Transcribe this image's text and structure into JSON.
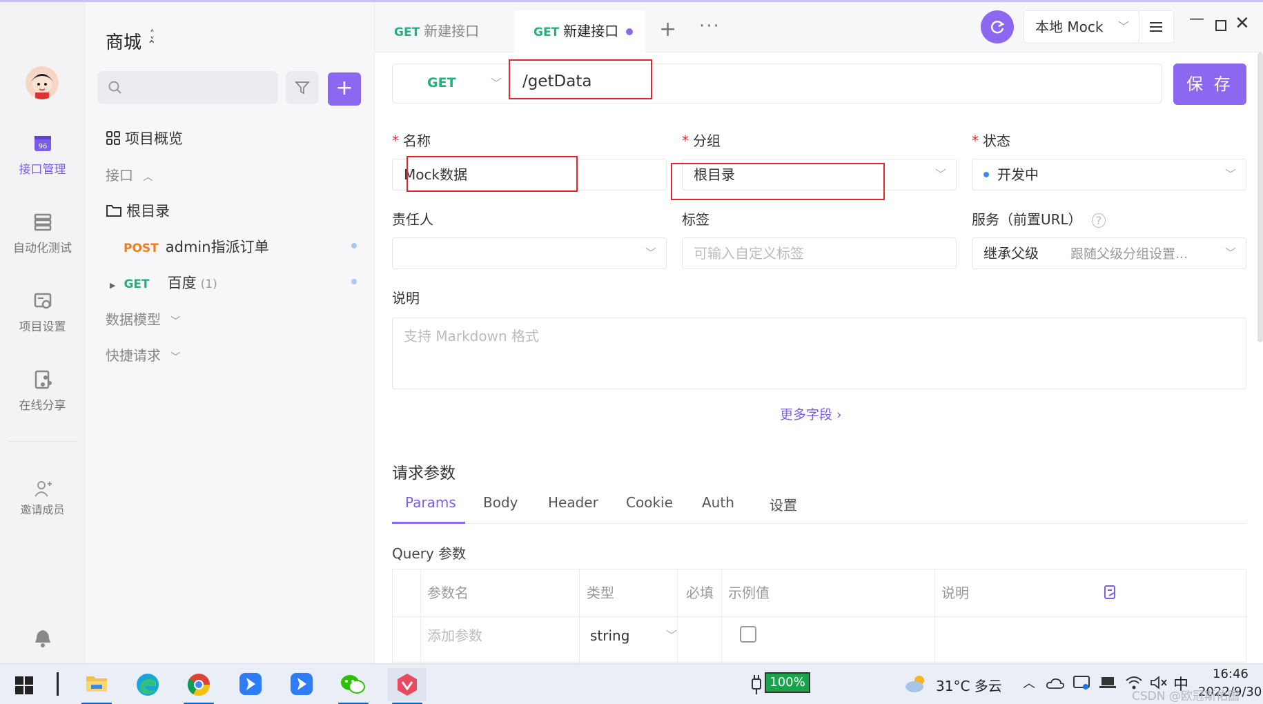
{
  "project": {
    "title": "商城",
    "switch_icon": "updown-icon"
  },
  "rail": {
    "items": [
      {
        "label": "接口管理",
        "icon": "api-icon"
      },
      {
        "label": "自动化测试",
        "icon": "layers-icon"
      },
      {
        "label": "项目设置",
        "icon": "settings-icon"
      },
      {
        "label": "在线分享",
        "icon": "share-icon"
      },
      {
        "label": "邀请成员",
        "icon": "invite-icon"
      }
    ]
  },
  "panel": {
    "overview": "项目概览",
    "api_section": "接口",
    "root_folder": "根目录",
    "items": [
      {
        "method": "POST",
        "name": "admin指派订单"
      },
      {
        "method": "GET",
        "name": "百度",
        "count": "(1)"
      }
    ],
    "data_model": "数据模型",
    "quick_request": "快捷请求"
  },
  "tabs": [
    {
      "method": "GET",
      "title": "新建接口"
    },
    {
      "method": "GET",
      "title": "新建接口"
    }
  ],
  "toolbar": {
    "environment": "本地 Mock"
  },
  "request": {
    "method": "GET",
    "path": "/getData",
    "save_label": "保 存"
  },
  "form": {
    "name_label": "名称",
    "name_value": "Mock数据",
    "group_label": "分组",
    "group_value": "根目录",
    "status_label": "状态",
    "status_value": "开发中",
    "owner_label": "责任人",
    "tags_label": "标签",
    "tags_placeholder": "可输入自定义标签",
    "service_label": "服务（前置URL）",
    "service_value": "继承父级",
    "service_hint": "跟随父级分组设置...",
    "desc_label": "说明",
    "desc_placeholder": "支持 Markdown 格式",
    "more_fields": "更多字段 ›"
  },
  "params": {
    "title": "请求参数",
    "tabs": [
      "Params",
      "Body",
      "Header",
      "Cookie",
      "Auth",
      "设置"
    ],
    "query_title": "Query 参数",
    "columns": [
      "参数名",
      "类型",
      "必填",
      "示例值",
      "说明"
    ],
    "add_placeholder": "添加参数",
    "default_type": "string"
  },
  "taskbar": {
    "battery": "100%",
    "weather": "31°C  多云",
    "ime": "中",
    "time": "16:46",
    "date": "2022/9/30",
    "watermark": "CSDN @欧冠斯佑国"
  },
  "colors": {
    "accent": "#8c68f0",
    "get": "#22b07d",
    "post": "#f07b1d",
    "highlight": "#e3262c"
  }
}
